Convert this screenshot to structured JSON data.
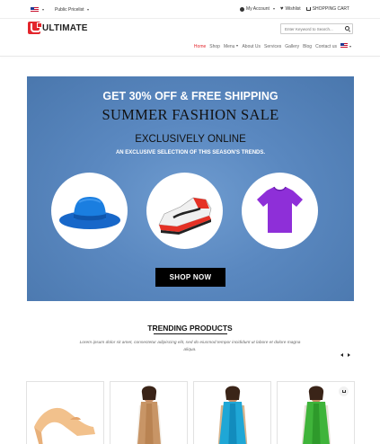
{
  "topbar": {
    "language_icon": "us-flag-icon",
    "pricelist": "Public Pricelist",
    "account": "My Account",
    "wishlist": "Wishlist",
    "cart": "SHOPPING CART"
  },
  "header": {
    "logo_text": "ULTIMATE",
    "search_placeholder": "Enter Keyword to Search..."
  },
  "nav": {
    "items": [
      "Home",
      "Shop",
      "Menu",
      "About Us",
      "Services",
      "Gallery",
      "Blog",
      "Contact us"
    ]
  },
  "banner": {
    "line1": "GET 30% OFF & FREE SHIPPING",
    "line2": "SUMMER FASHION SALE",
    "line3": "EXCLUSIVELY ONLINE",
    "line4": "AN EXCLUSIVE SELECTION OF THIS SEASON'S TRENDS.",
    "button": "SHOP NOW",
    "products": [
      "hat-image",
      "sneaker-image",
      "tshirt-image"
    ]
  },
  "trending": {
    "title": "TRENDING PRODUCTS",
    "description": "Lorem ipsum dolor sit amet, consectetur adipiscing elit, sed do eiusmod tempor incididunt ut labore et dolore magna aliqua."
  },
  "colors": {
    "accent": "#e3262c",
    "banner_bg": "#5a88c0",
    "hat": "#1a73d9",
    "tshirt": "#8e2fd8"
  }
}
